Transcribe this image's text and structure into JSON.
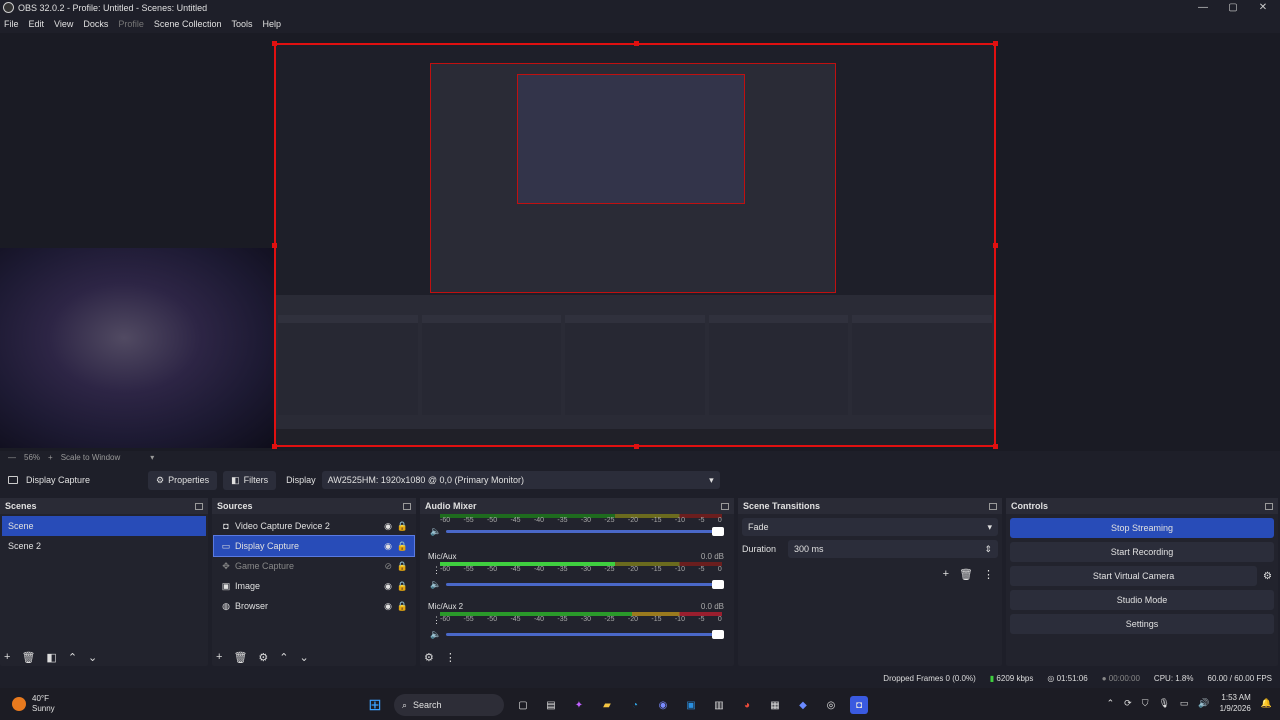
{
  "window": {
    "title": "OBS 32.0.2 - Profile: Untitled - Scenes: Untitled",
    "minimize": "—",
    "maximize": "▢",
    "close": "✕"
  },
  "menu": [
    "File",
    "Edit",
    "View",
    "Docks",
    "Profile",
    "Scene Collection",
    "Tools",
    "Help"
  ],
  "zoom": {
    "level": "56%",
    "plus": "+",
    "mode": "Scale to Window",
    "arrow": "▾"
  },
  "source_toolbar": {
    "current": "Display Capture",
    "properties": "Properties",
    "filters": "Filters",
    "display_label": "Display",
    "display_value": "AW2525HM: 1920x1080 @ 0,0 (Primary Monitor)"
  },
  "scenes": {
    "title": "Scenes",
    "items": [
      "Scene",
      "Scene 2"
    ],
    "selected": 0
  },
  "sources": {
    "title": "Sources",
    "items": [
      {
        "name": "Video Capture Device 2",
        "icon": "camera-icon",
        "visible": true
      },
      {
        "name": "Display Capture",
        "icon": "monitor-icon",
        "visible": true
      },
      {
        "name": "Game Capture",
        "icon": "gamepad-icon",
        "visible": false
      },
      {
        "name": "Image",
        "icon": "image-icon",
        "visible": true
      },
      {
        "name": "Browser",
        "icon": "globe-icon",
        "visible": true
      }
    ],
    "selected": 1
  },
  "mixer": {
    "title": "Audio Mixer",
    "ticks": [
      "-60",
      "-55",
      "-50",
      "-45",
      "-40",
      "-35",
      "-30",
      "-25",
      "-20",
      "-15",
      "-10",
      "-5",
      "0"
    ],
    "channels": [
      {
        "name": "",
        "db": ""
      },
      {
        "name": "Mic/Aux",
        "db": "0.0 dB"
      },
      {
        "name": "Mic/Aux 2",
        "db": "0.0 dB"
      }
    ]
  },
  "transitions": {
    "title": "Scene Transitions",
    "type": "Fade",
    "duration_label": "Duration",
    "duration_value": "300 ms"
  },
  "controls": {
    "title": "Controls",
    "buttons": [
      "Stop Streaming",
      "Start Recording",
      "Start Virtual Camera",
      "Studio Mode",
      "Settings"
    ]
  },
  "status": {
    "dropped": "Dropped Frames 0 (0.0%)",
    "bitrate": "6209 kbps",
    "stream_time": "01:51:06",
    "rec_time": "00:00:00",
    "cpu": "CPU: 1.8%",
    "fps": "60.00 / 60.00 FPS"
  },
  "taskbar": {
    "temp": "40°F",
    "condition": "Sunny",
    "search": "Search",
    "time": "1:53 AM",
    "date": "1/9/2026"
  },
  "colors": {
    "accent": "#284cb8",
    "border_red": "#e01010",
    "bg": "#1e1f29"
  }
}
